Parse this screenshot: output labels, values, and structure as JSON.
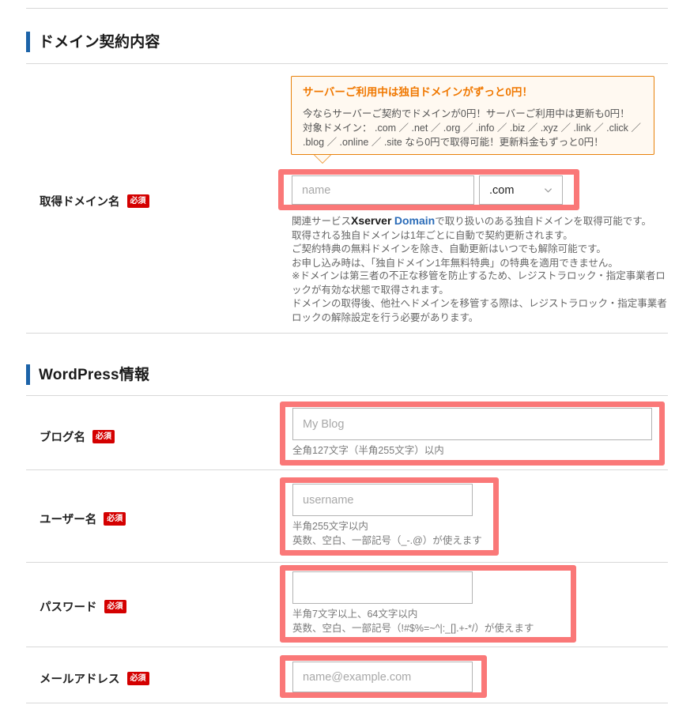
{
  "sections": [
    {
      "title": "ドメイン契約内容"
    },
    {
      "title": "WordPress情報"
    }
  ],
  "domain_section": {
    "callout": {
      "title": "サーバーご利用中は独自ドメインがずっと0円！",
      "line1": "今ならサーバーご契約でドメインが0円！サーバーご利用中は更新も0円！",
      "line2": "対象ドメイン：  .com ／ .net ／ .org ／ .info ／ .biz ／ .xyz ／ .link ／ .click ／",
      "line3": ".blog ／ .online ／ .site なら0円で取得可能！更新料金もずっと0円！",
      "border_color": "#e8820c",
      "background_color": "#fff9f1",
      "title_color": "#f07800"
    },
    "domain_row": {
      "label": "取得ドメイン名",
      "required_badge": "必須",
      "name_input": {
        "value": "",
        "placeholder": "name"
      },
      "tld_select": {
        "selected": ".com",
        "icon": "chevron-down-icon"
      },
      "help_block_1": {
        "line1_pre": "関連サービス",
        "line1_brand_x": "Xserver",
        "line1_brand_d": "Domain",
        "line1_post": "で取り扱いのある独自ドメインを取得可能です。",
        "line2": "取得される独自ドメインは1年ごとに自動で契約更新されます。",
        "line3": "ご契約特典の無料ドメインを除き、自動更新はいつでも解除可能です。",
        "line4": "お申し込み時は、「独自ドメイン1年無料特典」の特典を適用できません。"
      },
      "help_block_2": {
        "line1": "※ドメインは第三者の不正な移管を防止するため、レジストラロック・指定事業者ロ",
        "line2": "ックが有効な状態で取得されます。",
        "line3": "ドメインの取得後、他社へドメインを移管する際は、レジストラロック・指定事業者",
        "line4": "ロックの解除設定を行う必要があります。"
      }
    }
  },
  "wordpress_section": {
    "rows": [
      {
        "label": "ブログ名",
        "required_badge": "必須",
        "input": {
          "value": "",
          "placeholder": "My Blog"
        },
        "help": [
          "全角127文字（半角255文字）以内"
        ]
      },
      {
        "label": "ユーザー名",
        "required_badge": "必須",
        "input": {
          "value": "",
          "placeholder": "username"
        },
        "help": [
          "半角255文字以内",
          "英数、空白、一部記号（_-.@）が使えます"
        ]
      },
      {
        "label": "パスワード",
        "required_badge": "必須",
        "input": {
          "value": "",
          "placeholder": ""
        },
        "help": [
          "半角7文字以上、64文字以内",
          "英数、空白、一部記号（!#$%=~^|:_[].+-*/）が使えます"
        ]
      },
      {
        "label": "メールアドレス",
        "required_badge": "必須",
        "input": {
          "value": "",
          "placeholder": "name@example.com"
        },
        "help": []
      }
    ]
  },
  "theme": {
    "accent_bar": "#1c63a8",
    "required_badge_bg": "#d40000",
    "highlight_outline": "#fa7878",
    "divider": "#d8d8d8"
  }
}
